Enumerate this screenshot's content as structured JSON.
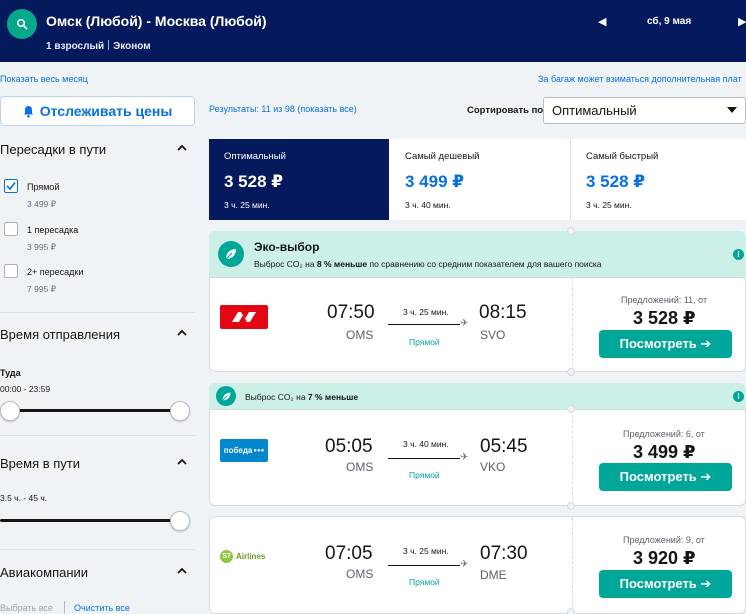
{
  "header": {
    "route": "Омск (Любой) - Москва (Любой)",
    "passengers": "1 взрослый",
    "cabin": "Эконом",
    "date": "сб, 9 мая",
    "prev": "◀",
    "next": "▶"
  },
  "top_links": {
    "show_month": "Показать весь месяц",
    "baggage_note": "За багаж может взиматься дополнительная плат"
  },
  "sidebar": {
    "track_button": "Отслеживать цены",
    "stops": {
      "title": "Пересадки в пути",
      "options": [
        {
          "label": "Прямой",
          "price": "3 499 ₽",
          "checked": true
        },
        {
          "label": "1 пересадка",
          "price": "3 995 ₽",
          "checked": false
        },
        {
          "label": "2+ пересадки",
          "price": "7 995 ₽",
          "checked": false
        }
      ]
    },
    "departure": {
      "title": "Время отправления",
      "sub": "Туда",
      "range": "00:00 - 23:59"
    },
    "duration": {
      "title": "Время в пути",
      "range": "3.5 ч. - 45 ч."
    },
    "airlines": {
      "title": "Авиакомпании",
      "select_all": "Выбрать все",
      "clear_all": "Очистить все"
    }
  },
  "results": {
    "count_text": "Результаты: 11 из 98 (показать все)",
    "sort_label": "Сортировать по",
    "sort_value": "Оптимальный"
  },
  "tabs": [
    {
      "title": "Оптимальный",
      "price": "3 528 ₽",
      "duration": "3 ч. 25 мин."
    },
    {
      "title": "Самый дешевый",
      "price": "3 499 ₽",
      "duration": "3 ч. 40 мин."
    },
    {
      "title": "Самый быстрый",
      "price": "3 528 ₽",
      "duration": "3 ч. 25 мин."
    }
  ],
  "eco": {
    "title": "Эко-выбор",
    "line1_prefix": "Выброс CO₂ на ",
    "line1_bold": "8 % меньше",
    "line1_suffix": " по сравнению со средним показателем для вашего поиска",
    "line2_prefix": "Выброс CO₂ на ",
    "line2_bold": "7 % меньше",
    "info": "i"
  },
  "flights": [
    {
      "airline": "Nordwind",
      "dep": "07:50",
      "dep_code": "OMS",
      "duration": "3 ч. 25 мин.",
      "stops": "Прямой",
      "arr": "08:15",
      "arr_code": "SVO",
      "offers": "Предложений: 11, от",
      "price": "3 528 ₽",
      "button": "Посмотреть ➔"
    },
    {
      "airline": "победа",
      "dep": "05:05",
      "dep_code": "OMS",
      "duration": "3 ч. 40 мин.",
      "stops": "Прямой",
      "arr": "05:45",
      "arr_code": "VKO",
      "offers": "Предложений: 6, от",
      "price": "3 499 ₽",
      "button": "Посмотреть ➔"
    },
    {
      "airline": "Airlines",
      "airline_mark": "S7",
      "dep": "07:05",
      "dep_code": "OMS",
      "duration": "3 ч. 25 мин.",
      "stops": "Прямой",
      "arr": "07:30",
      "arr_code": "DME",
      "offers": "Предложений: 9, от",
      "price": "3 920 ₽",
      "button": "Посмотреть ➔"
    }
  ],
  "colors": {
    "header_bg": "#041a5c",
    "accent_teal": "#00a698",
    "link_blue": "#0770e3",
    "eco_bg": "#ccefe8",
    "nordwind_red": "#e30613",
    "pobeda_blue": "#0087cd"
  },
  "icons": [
    "search-icon",
    "bell-icon",
    "check-icon",
    "chevron-up-icon",
    "leaf-icon",
    "info-icon",
    "plane-icon",
    "caret-down-icon"
  ]
}
